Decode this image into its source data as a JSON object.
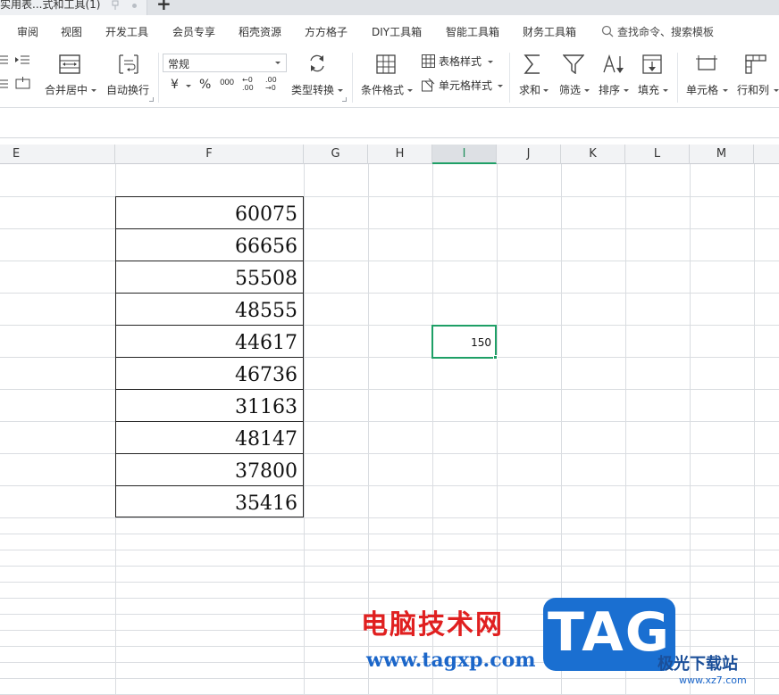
{
  "tab": {
    "title": "实用表...式和工具(1)",
    "new_tab_symbol": "+"
  },
  "menu": {
    "items": [
      "审阅",
      "视图",
      "开发工具",
      "会员专享",
      "稻壳资源",
      "方方格子",
      "DIY工具箱",
      "智能工具箱",
      "财务工具箱"
    ],
    "search_placeholder": "查找命令、搜索模板"
  },
  "ribbon": {
    "merge_center": "合并居中",
    "wrap_text": "自动换行",
    "number_format": "常规",
    "currency_symbol": "¥",
    "percent_symbol": "%",
    "thousands_symbol": "000",
    "inc_decimal": "←0 .00",
    "dec_decimal": ".00 →0",
    "type_convert": "类型转换",
    "conditional_format": "条件格式",
    "table_style": "表格样式",
    "cell_style": "单元格样式",
    "sum": "求和",
    "filter": "筛选",
    "sort": "排序",
    "fill": "填充",
    "cell": "单元格",
    "row_col": "行和列"
  },
  "columns": [
    "E",
    "F",
    "G",
    "H",
    "I",
    "J",
    "K",
    "L",
    "M"
  ],
  "active_column": "I",
  "data_values": [
    "60075",
    "66656",
    "55508",
    "48555",
    "44617",
    "46736",
    "31163",
    "48147",
    "37800",
    "35416"
  ],
  "selected_cell_value": "150",
  "watermark": {
    "site_name": "电脑技术网",
    "url": "www.tagxp.com",
    "logo_text": "TAG",
    "secondary_name": "极光下载站",
    "secondary_url": "www.xz7.com"
  }
}
